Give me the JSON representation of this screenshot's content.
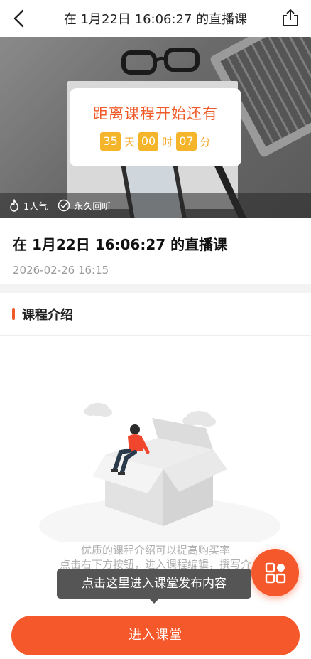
{
  "header": {
    "title": "在 1月22日 16:06:27 的直播课",
    "back_icon": "chevron-left-icon",
    "share_icon": "share-icon"
  },
  "countdown": {
    "label": "距离课程开始还有",
    "days": "35",
    "days_unit": "天",
    "hours": "00",
    "hours_unit": "时",
    "minutes": "07",
    "minutes_unit": "分"
  },
  "stats": {
    "popularity": "1人气",
    "replay": "永久回听"
  },
  "course": {
    "title": "在 1月22日 16:06:27 的直播课",
    "date": "2026-02-26 16:15"
  },
  "intro": {
    "heading": "课程介绍",
    "hint_line1": "优质的课程介绍可以提高购买率",
    "hint_line2": "点击右下方按钮，进入课程编辑，撰写介"
  },
  "tooltip": {
    "text": "点击这里进入课堂发布内容"
  },
  "actions": {
    "enter_label": "进入课堂"
  },
  "colors": {
    "accent": "#f5582a",
    "countdown_text": "#f05a28",
    "timer_bg": "#f5b52a"
  }
}
